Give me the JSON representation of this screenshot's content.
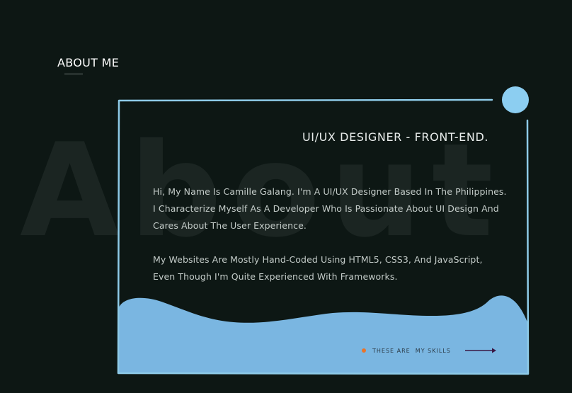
{
  "section": {
    "title": "ABOUT ME",
    "watermark": "About"
  },
  "card": {
    "role": "UI/UX DESIGNER - FRONT-END.",
    "paragraphs": [
      [
        "Hi, My Name Is Camille Galang. I'm A UI/UX Designer Based In The Philippines.",
        "I Characterize Myself As A Developer Who Is Passionate About UI Design And",
        "Cares About The User Experience."
      ],
      [
        "My Websites Are Mostly Hand-Coded Using HTML5, CSS3, And JavaScript,",
        "Even Though I'm Quite Experienced With Frameworks."
      ]
    ],
    "skills_link": "THESE ARE  MY SKILLS"
  },
  "colors": {
    "background": "#0d1714",
    "frame_line": "#8ecbe8",
    "wave": "#7ab6e1",
    "circle": "#8ccef1",
    "dot": "#e8742b",
    "arrow": "#3b1845"
  },
  "icons": {
    "decor_circle": "circle-decoration-icon",
    "arrow": "arrow-right-icon",
    "dot": "dot-icon"
  }
}
